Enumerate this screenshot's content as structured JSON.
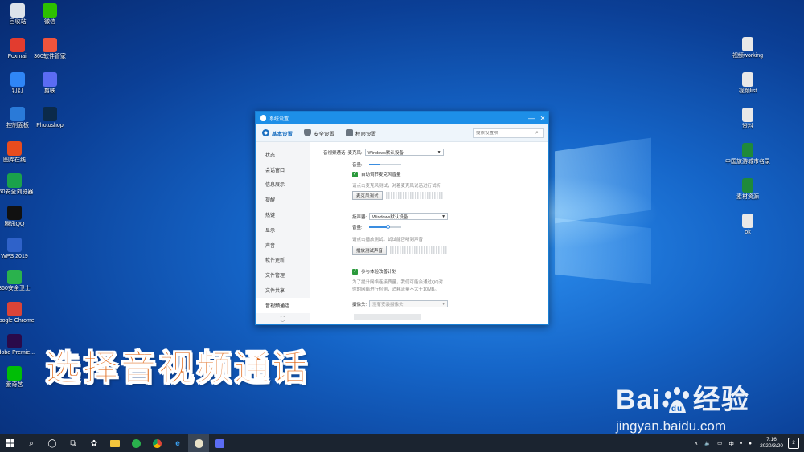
{
  "desktop_left": [
    {
      "label": "回收站",
      "color": "#dde3ea"
    },
    {
      "label": "微信",
      "color": "#2dc100"
    },
    {
      "label": "Foxmail",
      "color": "#e23c2f"
    },
    {
      "label": "360软件管家",
      "color": "#f0543c",
      "badge": "12"
    },
    {
      "label": "钉钉",
      "color": "#2f86f6"
    },
    {
      "label": "剪映",
      "color": "#5b6cf3"
    },
    {
      "label": "控制面板",
      "color": "#2a7ad8"
    },
    {
      "label": "Photoshop",
      "color": "#0b2a4a"
    },
    {
      "label": "图库在线",
      "color": "#e84c1e"
    },
    {
      "label": "360安全浏览器",
      "color": "#1aa24b"
    },
    {
      "label": "腾讯QQ",
      "color": "#111111"
    },
    {
      "label": "WPS 2019",
      "color": "#2f62c9"
    },
    {
      "label": "360安全卫士",
      "color": "#2ab24d"
    },
    {
      "label": "Google Chrome",
      "color": "#db4437"
    },
    {
      "label": "Adobe Premie...",
      "color": "#2a0a4a"
    },
    {
      "label": "爱奇艺",
      "color": "#00be06"
    }
  ],
  "desktop_right": [
    {
      "label": "视频working",
      "color": "#e8e8e8"
    },
    {
      "label": "视频list",
      "color": "#e8e8e8"
    },
    {
      "label": "资料",
      "color": "#e8e8e8"
    },
    {
      "label": "中国旅游城市名录",
      "color": "#1f8a3a"
    },
    {
      "label": "素材资源",
      "color": "#1f8a3a"
    },
    {
      "label": "ok",
      "color": "#e8e8e8"
    }
  ],
  "dialog": {
    "title": "系统设置",
    "minimize": "—",
    "close": "✕",
    "tabs": [
      "基本设置",
      "安全设置",
      "权限设置"
    ],
    "search_placeholder": "搜索设置项",
    "sidebar": [
      "状态",
      "会话窗口",
      "信息展示",
      "提醒",
      "热键",
      "显示",
      "声音",
      "软件更新",
      "文件管理",
      "文件共享",
      "音视频通话"
    ],
    "sidebar_active": "音视频通话",
    "section_label": "音视频通话",
    "mic_label": "麦克风:",
    "mic_value": "Windows默认设备",
    "volume_label": "音量:",
    "mic_volume": 0.35,
    "auto_adjust": "自动调节麦克风音量",
    "mic_hint": "请点击麦克风测试，对着麦克风说话进行试听",
    "mic_test_button": "麦克风测试",
    "speaker_label": "扬声器:",
    "speaker_value": "Windows默认设备",
    "speaker_volume": 0.62,
    "speaker_hint": "请点击播放测试，试试能否听到声音",
    "speaker_test_button": "播放测试声音",
    "experience_plan": "参与体验改善计划",
    "plan_hint_1": "为了提升网络连接质量，我们可能会通过QQ对",
    "plan_hint_2": "你的网络进行检测，消耗流量不大于10MB。",
    "camera_label": "摄像头:",
    "camera_value": "没有安装摄像头"
  },
  "caption": "选择音视频通话",
  "watermark": {
    "brand": "Bai",
    "brand_cn": "经验",
    "url": "jingyan.baidu.com"
  },
  "taskbar": {
    "lang": "中",
    "time": "7:16",
    "date": "2020/3/20",
    "notif_count": "2"
  }
}
